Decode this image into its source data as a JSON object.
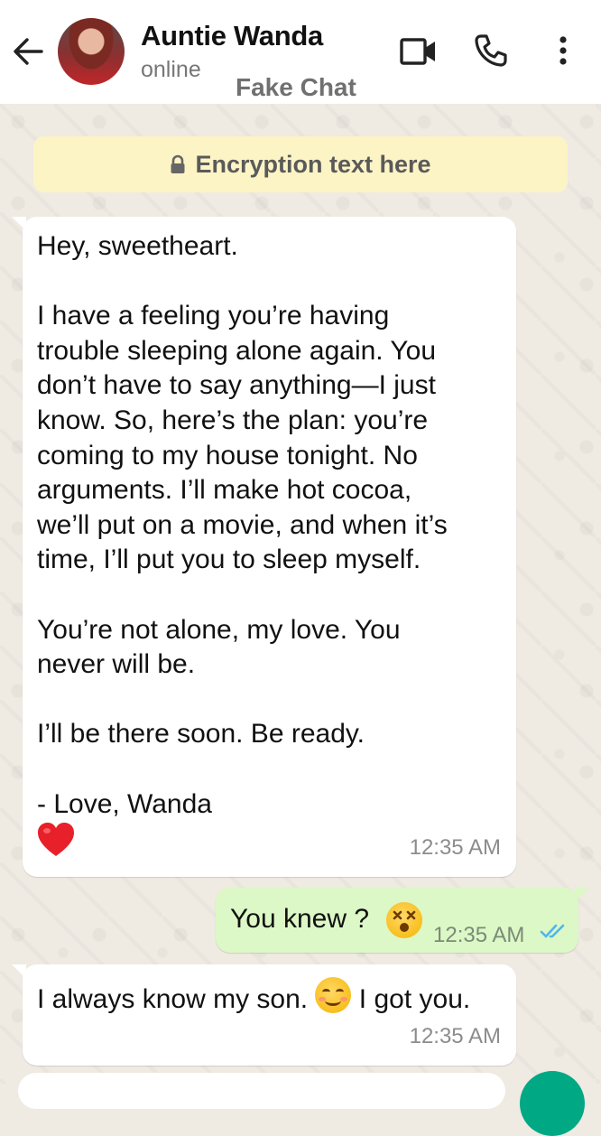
{
  "header": {
    "contact_name": "Auntie Wanda",
    "status": "online",
    "watermark": "Fake Chat"
  },
  "icons": {
    "back": "arrow-left-icon",
    "video": "video-camera-icon",
    "call": "phone-icon",
    "menu": "more-vertical-icon",
    "lock": "lock-icon",
    "read": "double-check-icon"
  },
  "colors": {
    "chat_bg": "#efeae2",
    "incoming_bubble": "#ffffff",
    "outgoing_bubble": "#dcf8c6",
    "encryption_banner": "#fdf4c5",
    "read_ticks": "#4fb6ec"
  },
  "encryption_notice": "Encryption text here",
  "messages": [
    {
      "direction": "incoming",
      "text": "Hey, sweetheart.\n\nI have a feeling you’re having\ntrouble sleeping alone again. You\ndon’t have to say anything—I just\nknow. So, here’s the plan: you’re\ncoming to my house tonight. No\narguments. I’ll make hot cocoa,\nwe’ll put on a movie, and when it’s\ntime, I’ll put you to sleep myself.\n\nYou’re not alone, my love. You\nnever will be.\n\nI’ll be there soon. Be ready.\n\n- Love, Wanda",
      "emoji": "❤️",
      "time": "12:35 AM"
    },
    {
      "direction": "outgoing",
      "text": "You knew ?",
      "emoji": "dizzy-face",
      "time": "12:35 AM",
      "status": "read"
    },
    {
      "direction": "incoming",
      "text_before": "I always know my son.",
      "emoji": "smiling-face",
      "text_after": "I got you.",
      "time": "12:35 AM"
    }
  ]
}
